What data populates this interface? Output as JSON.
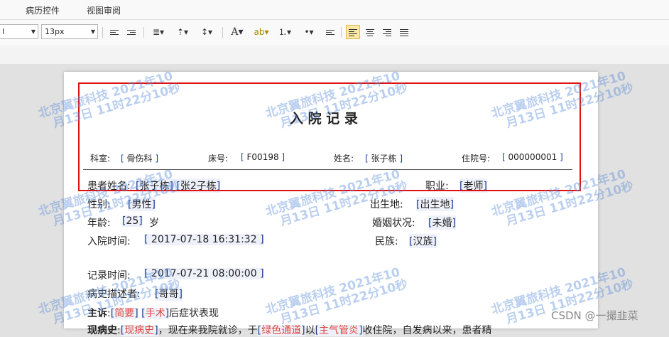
{
  "menu": {
    "item1": "病历控件",
    "item2": "视图审阅"
  },
  "toolbar": {
    "font_name": "l",
    "font_size": "13px"
  },
  "doc": {
    "title": "入 院 记 录",
    "header": {
      "dept_label": "科室:",
      "dept_value": "骨伤科",
      "bed_label": "床号:",
      "bed_value": "F00198",
      "name_label": "姓名:",
      "name_value": "张子栋",
      "adm_label": "住院号:",
      "adm_value": "000000001"
    },
    "patient_label": "患者姓名:",
    "patient_value1": "张子栋",
    "patient_value2": "张2子栋",
    "job_label": "职业:",
    "job_value": "老师",
    "gender_label": "性别:",
    "gender_value": "男性",
    "birth_label": "出生地:",
    "birth_value": "出生地",
    "age_label": "年龄:",
    "age_value": "25",
    "age_unit": "岁",
    "marital_label": "婚姻状况:",
    "marital_value": "未婚",
    "admit_label": "入院时间:",
    "admit_value": "2017-07-18 16:31:32",
    "ethnic_label": "民族:",
    "ethnic_value": "汉族",
    "record_label": "记录时间:",
    "record_value": "2017-07-21 08:00:00",
    "narrator_label": "病史描述者:",
    "narrator_value": "哥哥",
    "complaint_label": "主诉",
    "complaint_sep": ":",
    "complaint_v1": "简要",
    "complaint_v2": "手术",
    "complaint_tail": "后症状表现",
    "present_label": "现病史",
    "present_v1": "现病史",
    "present_text1": "，现在来我院就诊，于",
    "present_v2": "绿色通道",
    "present_text2": "以",
    "present_v3": "主气管炎",
    "present_text3": "收住院，自发病以来，患者精"
  },
  "watermark": {
    "line1": "北京翼旅科技 2021年10",
    "line2": "月13日 11时22分10秒"
  },
  "credit": "CSDN @一撮韭菜",
  "colors": {
    "highlight_border": "#e01010",
    "field_bg": "#eef1fa",
    "bracket": "#1c3d8f",
    "red_text": "#e0453a"
  }
}
